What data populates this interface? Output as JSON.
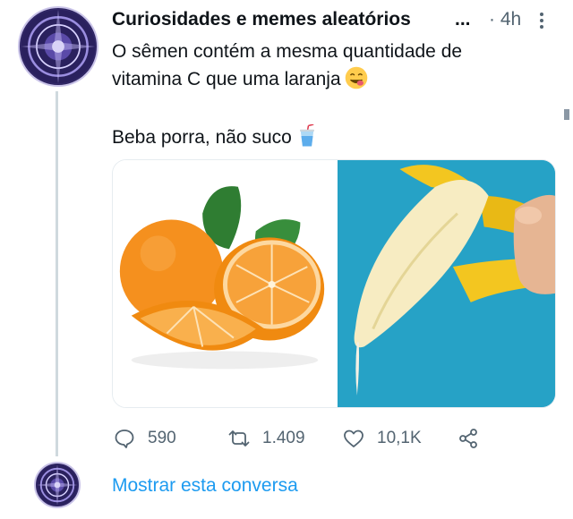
{
  "tweet": {
    "author_name": "Curiosidades e memes aleatórios",
    "name_ellipsis": "...",
    "time": "· 4h",
    "line1": "O sêmen contém a mesma quantidade de vitamina C que uma laranja",
    "line2": "Beba porra, não suco",
    "emoji_1": "face-savoring-food-icon",
    "emoji_2": "cup-with-straw-icon"
  },
  "media": {
    "left_image": "oranges-image",
    "right_image": "banana-image",
    "colors": {
      "right_background": "#26a2c6",
      "orange": "#f5901e",
      "banana": "#f2e6b0"
    }
  },
  "actions": {
    "reply_count": "590",
    "retweet_count": "1.409",
    "like_count": "10,1K"
  },
  "thread": {
    "show_label": "Mostrar esta conversa"
  },
  "colors": {
    "link": "#1d9bf0",
    "muted": "#536471",
    "thread_line": "#cfd9de"
  }
}
